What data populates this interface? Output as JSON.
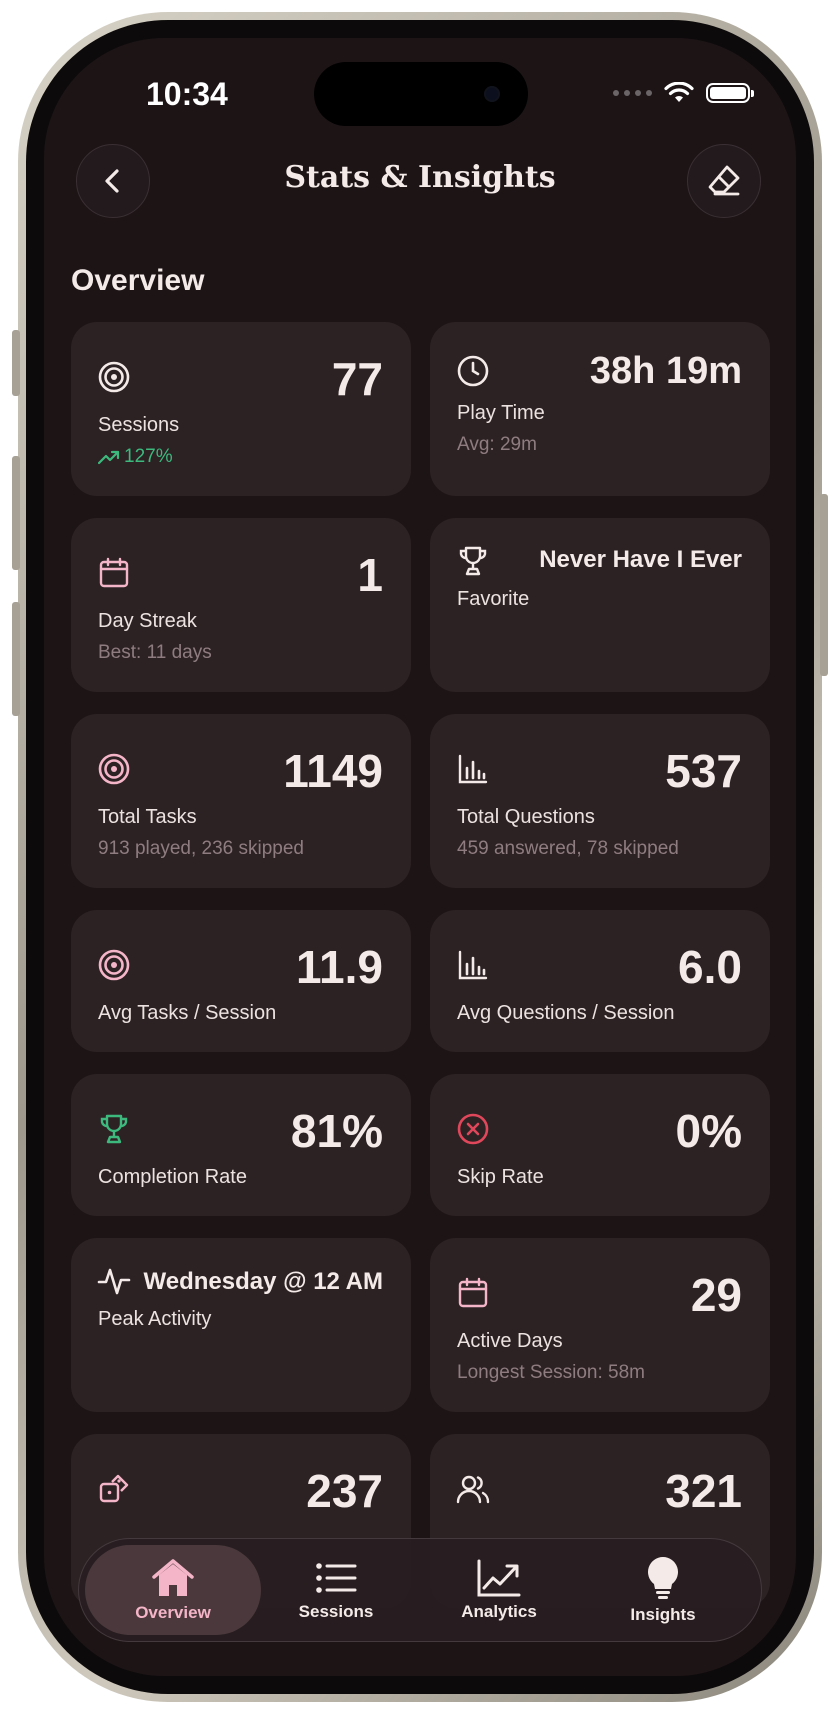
{
  "status": {
    "time": "10:34"
  },
  "header": {
    "title": "Stats & Insights"
  },
  "section": {
    "title": "Overview"
  },
  "cards": {
    "sessions": {
      "value": "77",
      "label": "Sessions",
      "trend": "127%"
    },
    "play_time": {
      "value": "38h 19m",
      "label": "Play Time",
      "sub": "Avg: 29m"
    },
    "streak": {
      "value": "1",
      "label": "Day Streak",
      "sub": "Best: 11 days"
    },
    "favorite": {
      "value": "Never Have I Ever",
      "label": "Favorite"
    },
    "total_tasks": {
      "value": "1149",
      "label": "Total Tasks",
      "sub": "913 played, 236 skipped"
    },
    "total_questions": {
      "value": "537",
      "label": "Total Questions",
      "sub": "459 answered, 78 skipped"
    },
    "avg_tasks": {
      "value": "11.9",
      "label": "Avg Tasks / Session"
    },
    "avg_questions": {
      "value": "6.0",
      "label": "Avg Questions / Session"
    },
    "completion": {
      "value": "81%",
      "label": "Completion Rate"
    },
    "skip": {
      "value": "0%",
      "label": "Skip Rate"
    },
    "peak": {
      "value": "Wednesday @ 12 AM",
      "label": "Peak Activity"
    },
    "active_days": {
      "value": "29",
      "label": "Active Days",
      "sub": "Longest Session: 58m"
    },
    "dice": {
      "value": "237"
    },
    "players": {
      "value": "321"
    }
  },
  "tabs": [
    {
      "label": "Overview",
      "icon": "house-icon"
    },
    {
      "label": "Sessions",
      "icon": "list-icon"
    },
    {
      "label": "Analytics",
      "icon": "chart-line-icon"
    },
    {
      "label": "Insights",
      "icon": "lightbulb-icon"
    }
  ],
  "colors": {
    "background": "#1d1416",
    "card": "#2c2224",
    "accent_pink": "#f5b5c9",
    "accent_green": "#3db97e",
    "accent_red": "#e0475a",
    "muted": "#8f7c80"
  }
}
